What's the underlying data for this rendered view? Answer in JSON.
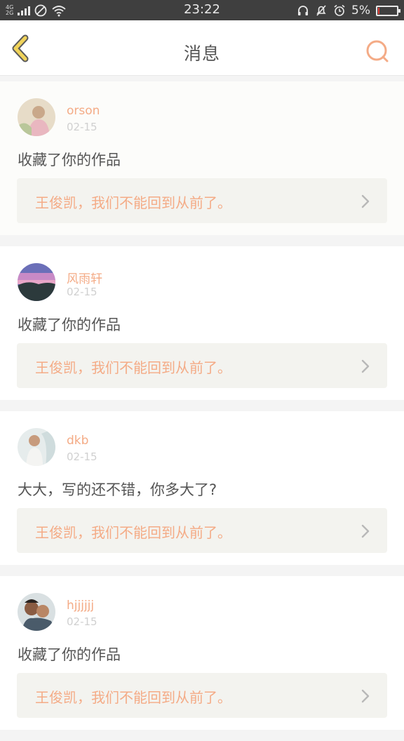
{
  "status_bar": {
    "network_top": "4G",
    "network_bottom": "2G",
    "time": "23:22",
    "battery_percent": "5%",
    "battery_level": 0.05,
    "icons": [
      "signal-icon",
      "no-sim-icon",
      "wifi-icon",
      "headset-icon",
      "mute-icon",
      "alarm-icon",
      "battery-icon"
    ]
  },
  "navbar": {
    "title": "消息",
    "back_icon": "chevron-left-icon",
    "search_icon": "search-icon"
  },
  "colors": {
    "accent": "#f4ab86",
    "back_icon": "#f0d35a",
    "battery_low": "#e0403a"
  },
  "messages": [
    {
      "user": "orson",
      "date": "02-15",
      "content": "收藏了你的作品",
      "work_title": "王俊凯，我们不能回到从前了。",
      "avatar": "avatar-photo-woman"
    },
    {
      "user": "风雨轩",
      "date": "02-15",
      "content": "收藏了你的作品",
      "work_title": "王俊凯，我们不能回到从前了。",
      "avatar": "avatar-photo-sunset"
    },
    {
      "user": "dkb",
      "date": "02-15",
      "content": "大大，写的还不错，你多大了?",
      "work_title": "王俊凯，我们不能回到从前了。",
      "avatar": "avatar-photo-girl"
    },
    {
      "user": "hjjjjjj",
      "date": "02-15",
      "content": "收藏了你的作品",
      "work_title": "王俊凯，我们不能回到从前了。",
      "avatar": "avatar-photo-children"
    }
  ]
}
